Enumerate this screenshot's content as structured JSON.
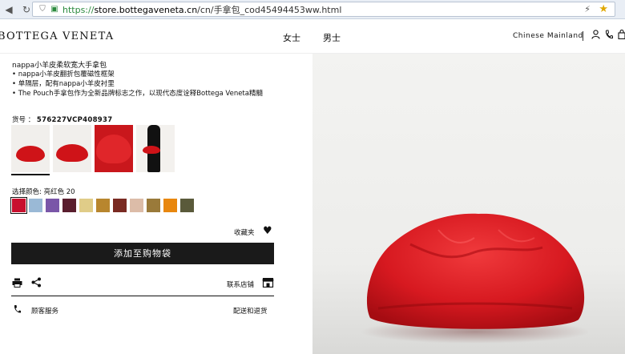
{
  "browser": {
    "url_scheme": "https://",
    "url_host": "store.bottegaveneta.cn",
    "url_path": "/cn/手拿包_cod45494453ww.html"
  },
  "header": {
    "logo": "BOTTEGA VENETA",
    "menu": [
      "女士",
      "男士"
    ],
    "region": "Chinese Mainland"
  },
  "product": {
    "title": "nappa小羊皮柔软宽大手拿包",
    "bullets": [
      "• nappa小羊皮翻折包覆磁性框架",
      "• 单隔层，配有nappa小羊皮衬里",
      "• The Pouch手拿包作为全新品牌标志之作，以现代态度诠释Bottega Veneta精髓"
    ],
    "sku_label": "货号 ：",
    "sku_value": "576227VCP408937",
    "color_label": "选择颜色: 亮红色 20",
    "swatch_colors": [
      "#c8102e",
      "#9ab9d6",
      "#7a56a8",
      "#5a1e2e",
      "#e0cc88",
      "#b8862e",
      "#7a2a22",
      "#dcbca8",
      "#9a7a3a",
      "#e8870e",
      "#5a5a3a"
    ],
    "favorite_label": "收藏夹",
    "add_to_bag": "添加至购物袋",
    "store_link": "联系店铺",
    "customer_service": "顾客服务",
    "shipping": "配送和退货"
  },
  "colors": {
    "accent_red": "#d71920",
    "button_dark": "#1a1a1a"
  }
}
